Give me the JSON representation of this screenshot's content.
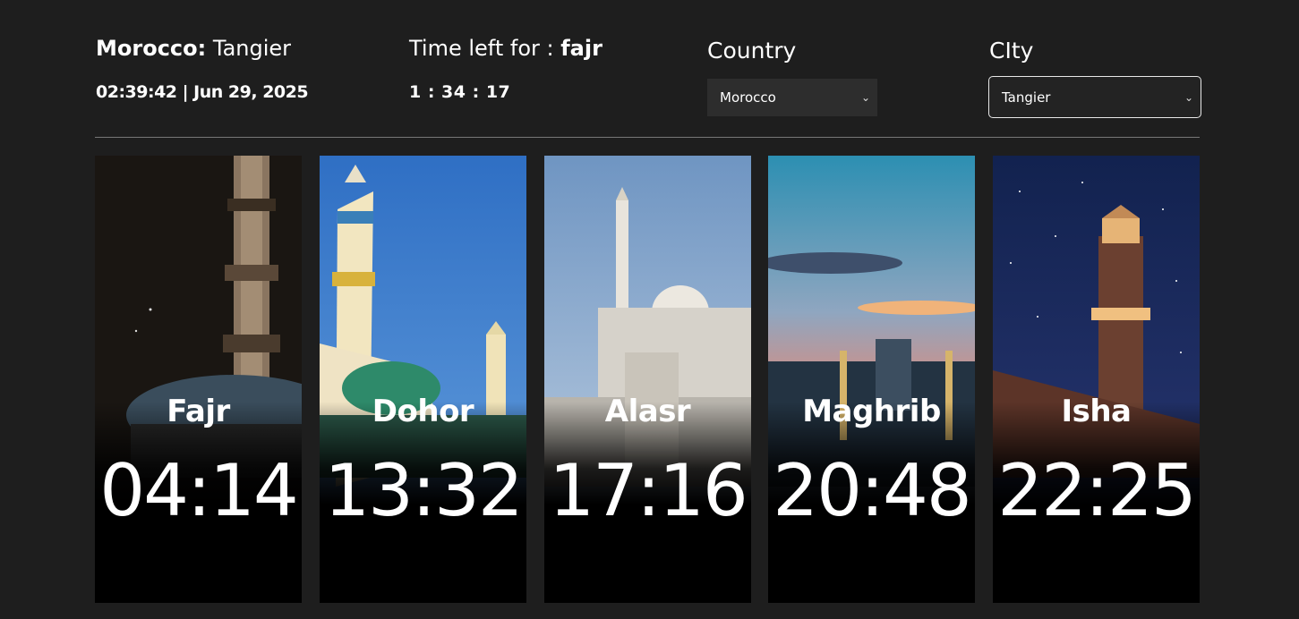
{
  "header": {
    "country_label": "Morocco:",
    "city_label": "Tangier",
    "datetime": "02:39:42 | Jun 29, 2025",
    "time_left_prefix": "Time left for :",
    "time_left_prayer": "fajr",
    "countdown": "1 : 34 : 17"
  },
  "filters": {
    "country_title": "Country",
    "country_value": "Morocco",
    "city_title": "CIty",
    "city_value": "Tangier"
  },
  "prayers": [
    {
      "name": "Fajr",
      "time": "04:14"
    },
    {
      "name": "Dohor",
      "time": "13:32"
    },
    {
      "name": "Alasr",
      "time": "17:16"
    },
    {
      "name": "Maghrib",
      "time": "20:48"
    },
    {
      "name": "Isha",
      "time": "22:25"
    }
  ]
}
